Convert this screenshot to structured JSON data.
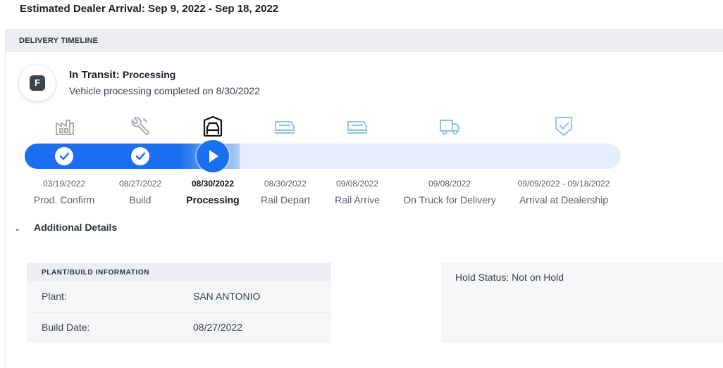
{
  "arrival": {
    "text": "Estimated Dealer Arrival: Sep 9, 2022 - Sep 18, 2022"
  },
  "timeline": {
    "header": "DELIVERY TIMELINE",
    "badge_letter": "F",
    "status_label": "In Transit:",
    "status_value": "Processing",
    "status_sub": "Vehicle processing completed on 8/30/2022",
    "progress_fraction": 0.36,
    "stages": [
      {
        "date": "03/19/2022",
        "label": "Prod. Confirm",
        "icon": "factory-icon",
        "state": "complete"
      },
      {
        "date": "08/27/2022",
        "label": "Build",
        "icon": "wrench-icon",
        "state": "complete"
      },
      {
        "date": "08/30/2022",
        "label": "Processing",
        "icon": "car-processing-icon",
        "state": "active"
      },
      {
        "date": "08/30/2022",
        "label": "Rail Depart",
        "icon": "rail-car-icon",
        "state": "pending"
      },
      {
        "date": "09/08/2022",
        "label": "Rail Arrive",
        "icon": "rail-car-icon",
        "state": "pending"
      },
      {
        "date": "09/08/2022",
        "label": "On Truck for Delivery",
        "icon": "truck-icon",
        "state": "pending"
      },
      {
        "date": "09/09/2022 - 09/18/2022",
        "label": "Arrival at Dealership",
        "icon": "shield-check-icon",
        "state": "pending"
      }
    ]
  },
  "details": {
    "toggle_label": "Additional Details",
    "plant_card": {
      "header": "PLANT/BUILD INFORMATION",
      "rows": [
        {
          "label": "Plant:",
          "value": "SAN ANTONIO"
        },
        {
          "label": "Build Date:",
          "value": "08/27/2022"
        }
      ]
    },
    "hold": {
      "text": "Hold Status: Not on Hold"
    }
  },
  "colors": {
    "accent": "#1a6ff0",
    "track": "#e4eefc",
    "pending_icon": "#8fc3e6",
    "done_icon": "#a9adb3"
  }
}
